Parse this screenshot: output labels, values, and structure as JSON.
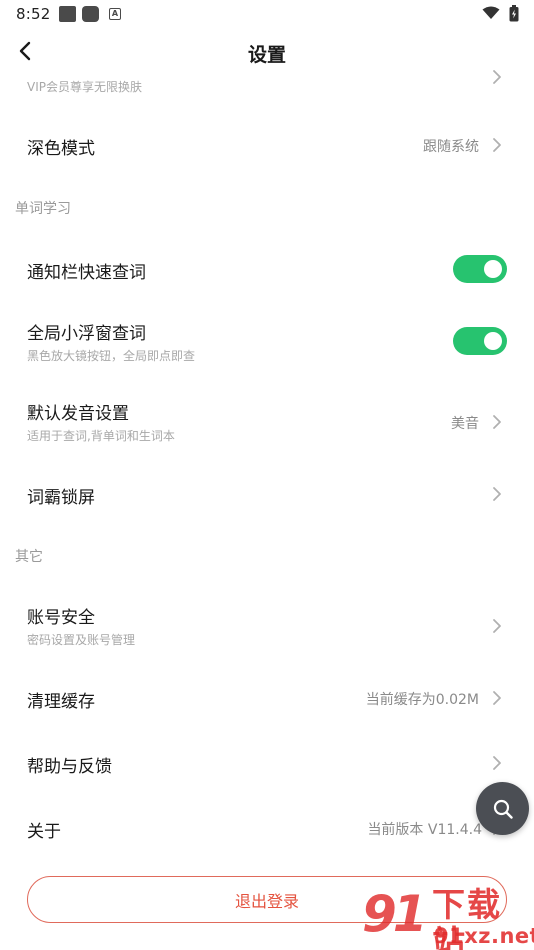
{
  "status_bar": {
    "time": "8:52"
  },
  "header": {
    "title": "设置"
  },
  "partial_row": {
    "subtitle": "VIP会员尊享无限换肤"
  },
  "dark_mode": {
    "title": "深色模式",
    "value": "跟随系统"
  },
  "section_words": {
    "label": "单词学习"
  },
  "notify_lookup": {
    "title": "通知栏快速查词",
    "enabled": true
  },
  "float_lookup": {
    "title": "全局小浮窗查词",
    "subtitle": "黑色放大镜按钮，全局即点即查",
    "enabled": true
  },
  "pronunciation": {
    "title": "默认发音设置",
    "subtitle": "适用于查词,背单词和生词本",
    "value": "美音"
  },
  "lockscreen": {
    "title": "词霸锁屏"
  },
  "section_other": {
    "label": "其它"
  },
  "account": {
    "title": "账号安全",
    "subtitle": "密码设置及账号管理"
  },
  "cache": {
    "title": "清理缓存",
    "value": "当前缓存为0.02M"
  },
  "help": {
    "title": "帮助与反馈"
  },
  "about": {
    "title": "关于",
    "value": "当前版本 V11.4.4"
  },
  "logout": {
    "label": "退出登录"
  },
  "watermark": {
    "digits": "91",
    "brand": "下载站",
    "url": "91xz.net"
  },
  "colors": {
    "toggle_on": "#27c36f",
    "logout": "#e4533f",
    "fab": "#4b4e54"
  },
  "icons": {
    "back": "chevron-left-icon",
    "row_arrow": "chevron-right-icon",
    "fab": "search-icon"
  }
}
